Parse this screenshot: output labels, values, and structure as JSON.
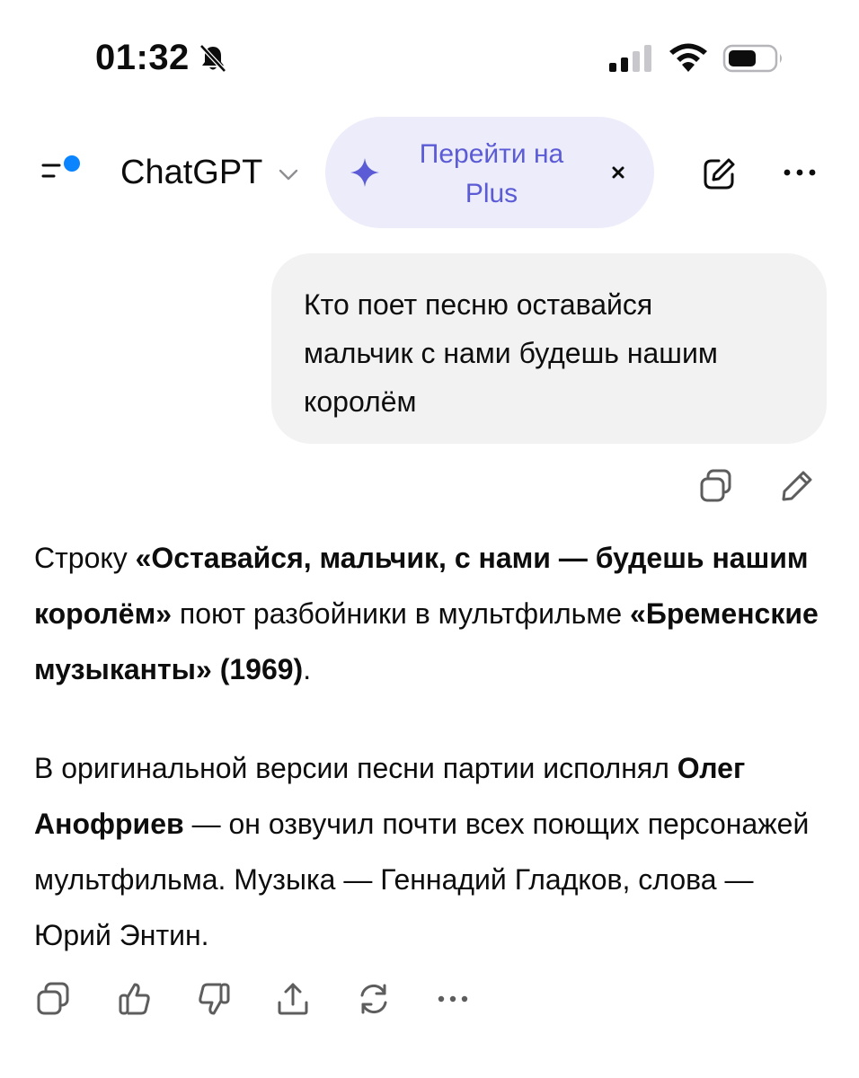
{
  "status_bar": {
    "time": "01:32",
    "icons": [
      "bell-slash-icon",
      "cellular-signal-icon",
      "wifi-icon",
      "battery-icon"
    ]
  },
  "header": {
    "model_name": "ChatGPT",
    "upgrade_banner": {
      "line1": "Перейти на",
      "line2": "Plus"
    },
    "icons": [
      "menu-icon",
      "chevron-down-icon",
      "sparkle-icon",
      "close-icon",
      "new-chat-icon",
      "more-icon"
    ]
  },
  "user_message": {
    "lines": [
      "Кто поет песню оставайся",
      "мальчик с нами будешь нашим",
      "королём"
    ]
  },
  "assistant_message": {
    "paragraph1": {
      "t1": "Строку ",
      "b1": "«Оставайся, мальчик, с нами — будешь нашим королём»",
      "t2": " поют разбойники в мультфильме ",
      "b2": "«Бременские музыканты» (1969)",
      "t3": "."
    },
    "paragraph2": {
      "t1": "В оригинальной версии песни партии исполнял ",
      "b1": "Олег Анофриев",
      "t2": " — он озвучил почти всех поющих персонажей мультфильма. Музыка — Геннадий Гладков, слова — Юрий Энтин."
    }
  },
  "accent_colors": {
    "brand_dot": "#0a84ff",
    "upgrade_bg": "#ececfb",
    "upgrade_text": "#5b5bd6",
    "user_bubble_bg": "#f2f2f2"
  }
}
